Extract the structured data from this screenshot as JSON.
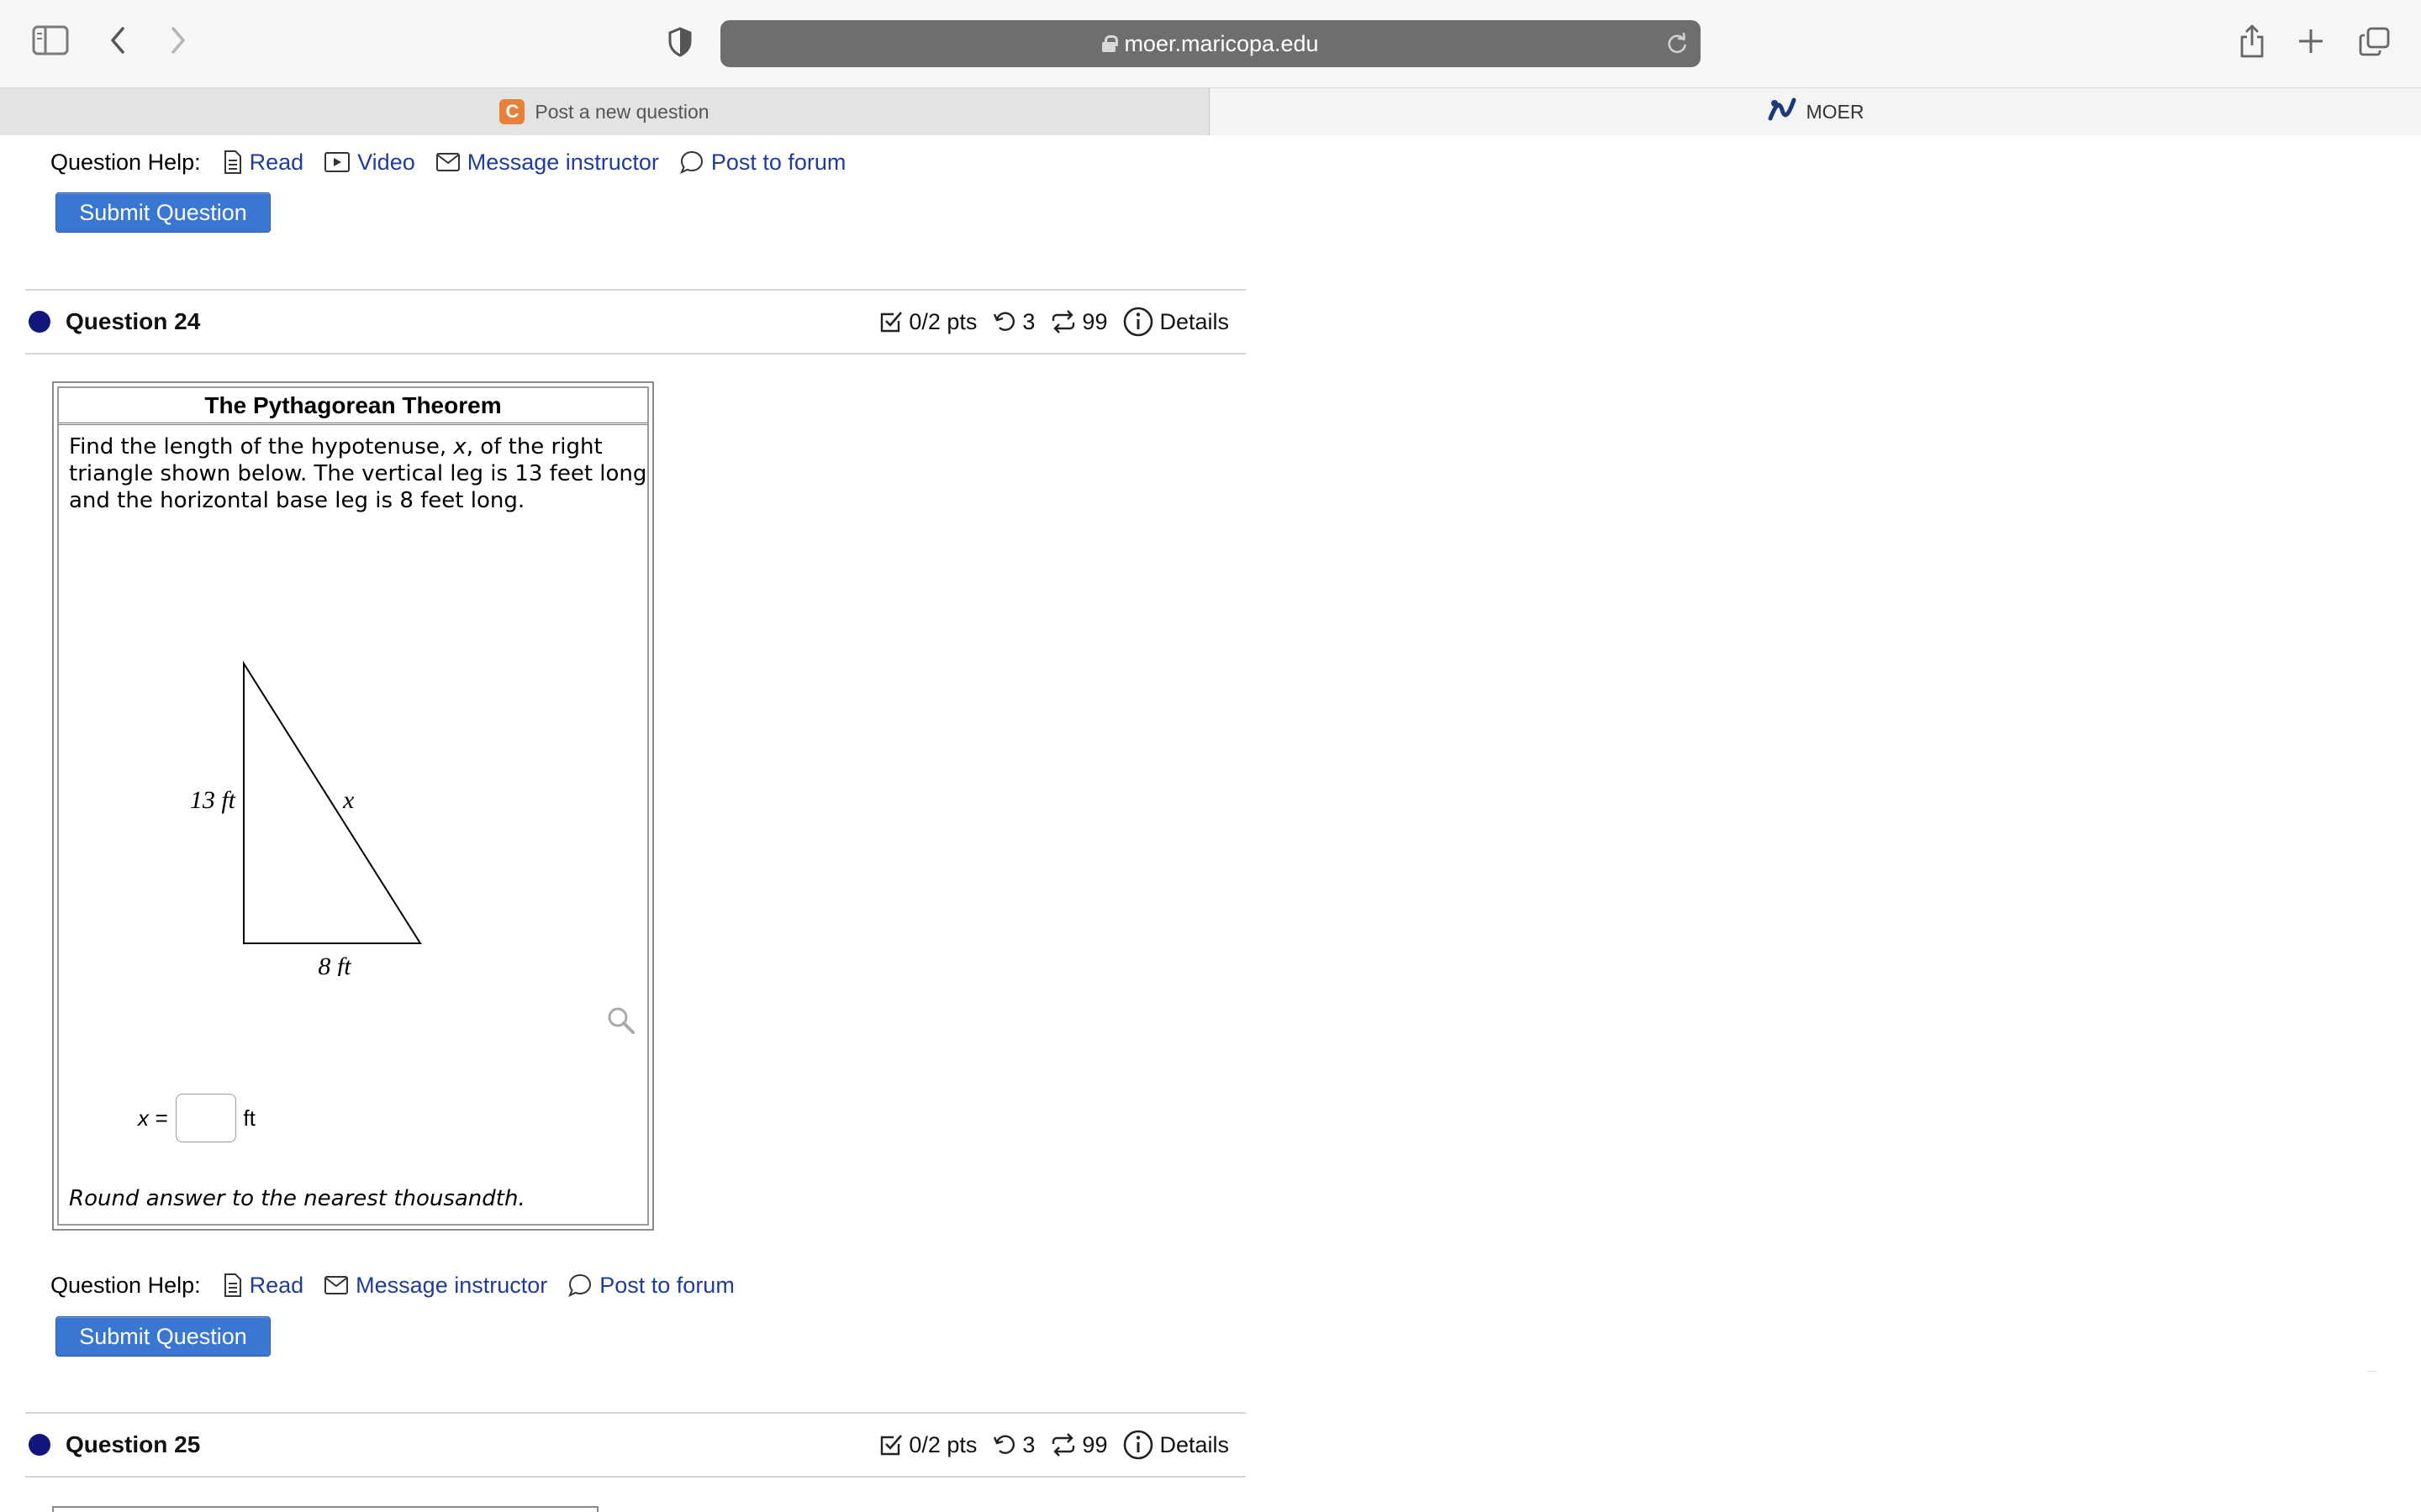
{
  "browser": {
    "url": "moer.maricopa.edu",
    "tabs": [
      {
        "label": "Post a new question",
        "favicon": "C"
      },
      {
        "label": "MOER"
      }
    ]
  },
  "help_top": {
    "label": "Question Help:",
    "links": [
      "Read",
      "Video",
      "Message instructor",
      "Post to forum"
    ]
  },
  "submit_label": "Submit Question",
  "question24": {
    "title": "Question 24",
    "pts": "0/2 pts",
    "retries": "3",
    "attempts": "99",
    "details": "Details"
  },
  "problem": {
    "title": "The Pythagorean Theorem",
    "text_before": "Find the length of the hypotenuse, ",
    "var": "x",
    "text_after": ", of the right triangle shown below. The vertical leg is 13 feet long and the horizontal base leg is 8 feet long.",
    "figure": {
      "vertical_label": "13 ft",
      "hyp_label": "x",
      "base_label": "8 ft"
    },
    "answer_label": "x =",
    "answer_value": "",
    "answer_unit": "ft",
    "note": "Round answer to the nearest thousandth."
  },
  "help_bottom": {
    "label": "Question Help:",
    "links": [
      "Read",
      "Message instructor",
      "Post to forum"
    ]
  },
  "question25": {
    "title": "Question 25",
    "pts": "0/2 pts",
    "retries": "3",
    "attempts": "99",
    "details": "Details"
  }
}
